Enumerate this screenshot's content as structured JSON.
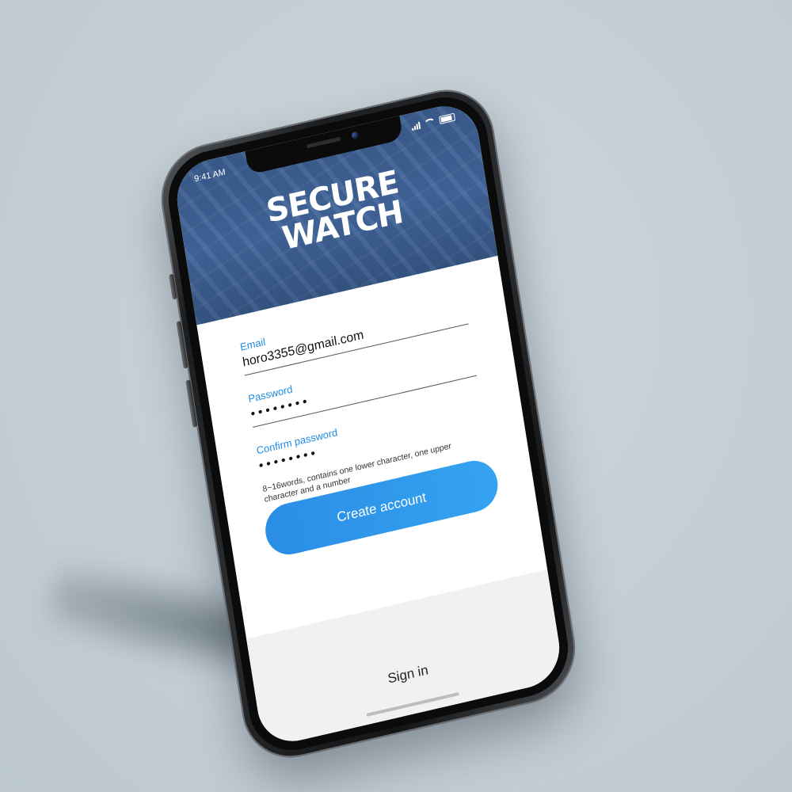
{
  "status": {
    "time": "9:41 AM"
  },
  "brand": {
    "line1": "SECURE",
    "line2": "WATCH"
  },
  "form": {
    "email": {
      "label": "Email",
      "value": "horo3355@gmail.com"
    },
    "password": {
      "label": "Password",
      "value": "••••••••"
    },
    "confirm_password": {
      "label": "Confirm password",
      "value": "••••••••"
    },
    "hint": "8~16words, contains one lower character, one upper character and a number"
  },
  "actions": {
    "create_account_label": "Create account",
    "sign_in_label": "Sign in"
  },
  "colors": {
    "accent": "#2b8de6",
    "hero": "#3a5c8e",
    "background": "#c5cfd6"
  },
  "icons": [
    "signal-icon",
    "wifi-icon",
    "battery-icon"
  ]
}
